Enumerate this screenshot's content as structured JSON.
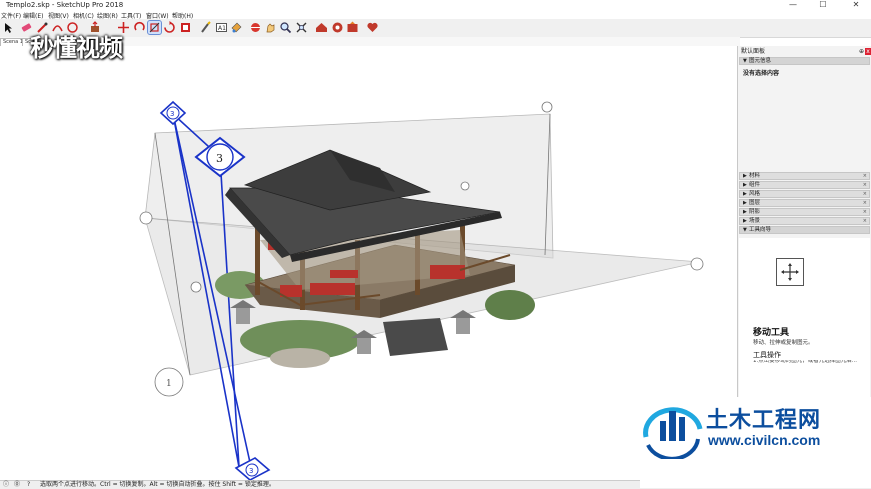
{
  "window": {
    "title": "Templo2.skp - SketchUp Pro 2018",
    "minimize": "—",
    "maximize": "☐",
    "close": "✕"
  },
  "menu": [
    "文件(F)",
    "编辑(E)",
    "视图(V)",
    "相机(C)",
    "绘图(R)",
    "工具(T)",
    "窗口(W)",
    "帮助(H)"
  ],
  "toolbar": {
    "tools": [
      "select-tool",
      "eraser-tool",
      "line-tool",
      "arc-tool",
      "shape-tool",
      "pushpull-tool",
      "move-tool",
      "rotate-tool",
      "scale-tool",
      "offset-tool",
      "tape-measure-tool",
      "text-tool",
      "paint-bucket-tool",
      "orbit-tool",
      "pan-tool",
      "zoom-tool",
      "zoom-extents-tool",
      "warehouse-tool",
      "extension-warehouse-tool",
      "share-model-tool",
      "extension-manager-tool"
    ],
    "active": "move-tool"
  },
  "scene_tabs": [
    "Scena 1",
    "Sc"
  ],
  "watermark": "秒懂视频",
  "viewport": {
    "protractor_marks": [
      "3",
      "3",
      "1",
      "3"
    ]
  },
  "tray": {
    "title": "默认面板",
    "pin": "⊕",
    "close": "x",
    "entity_info": {
      "label": "图元信息",
      "content": "没有选择内容"
    },
    "sections": [
      "材料",
      "组件",
      "风格",
      "图层",
      "阴影",
      "场景"
    ],
    "instructor": {
      "label": "工具向导",
      "tool_name": "移动工具",
      "tool_desc": "移动、拉伸或复制图元。",
      "operation_title": "工具操作",
      "operation_text": "1.点击要移动的图元，或者先选择图元后..."
    }
  },
  "statusbar": [
    "ⓘ",
    "⓪",
    "?",
    "选取两个点进行移动。Ctrl = 切换复制。Alt = 切换自动折叠。按住 Shift = 锁定推理。"
  ],
  "logo": {
    "name": "土木工程网",
    "url": "www.civilcn.com"
  },
  "colors": {
    "selection_blue": "#1a33c8",
    "plane_grey": "#d9d9d9",
    "logo_blue": "#0c4e9e",
    "logo_cyan": "#20a8e0",
    "roof": "#3a3a3a",
    "rail_red": "#b8322c"
  }
}
